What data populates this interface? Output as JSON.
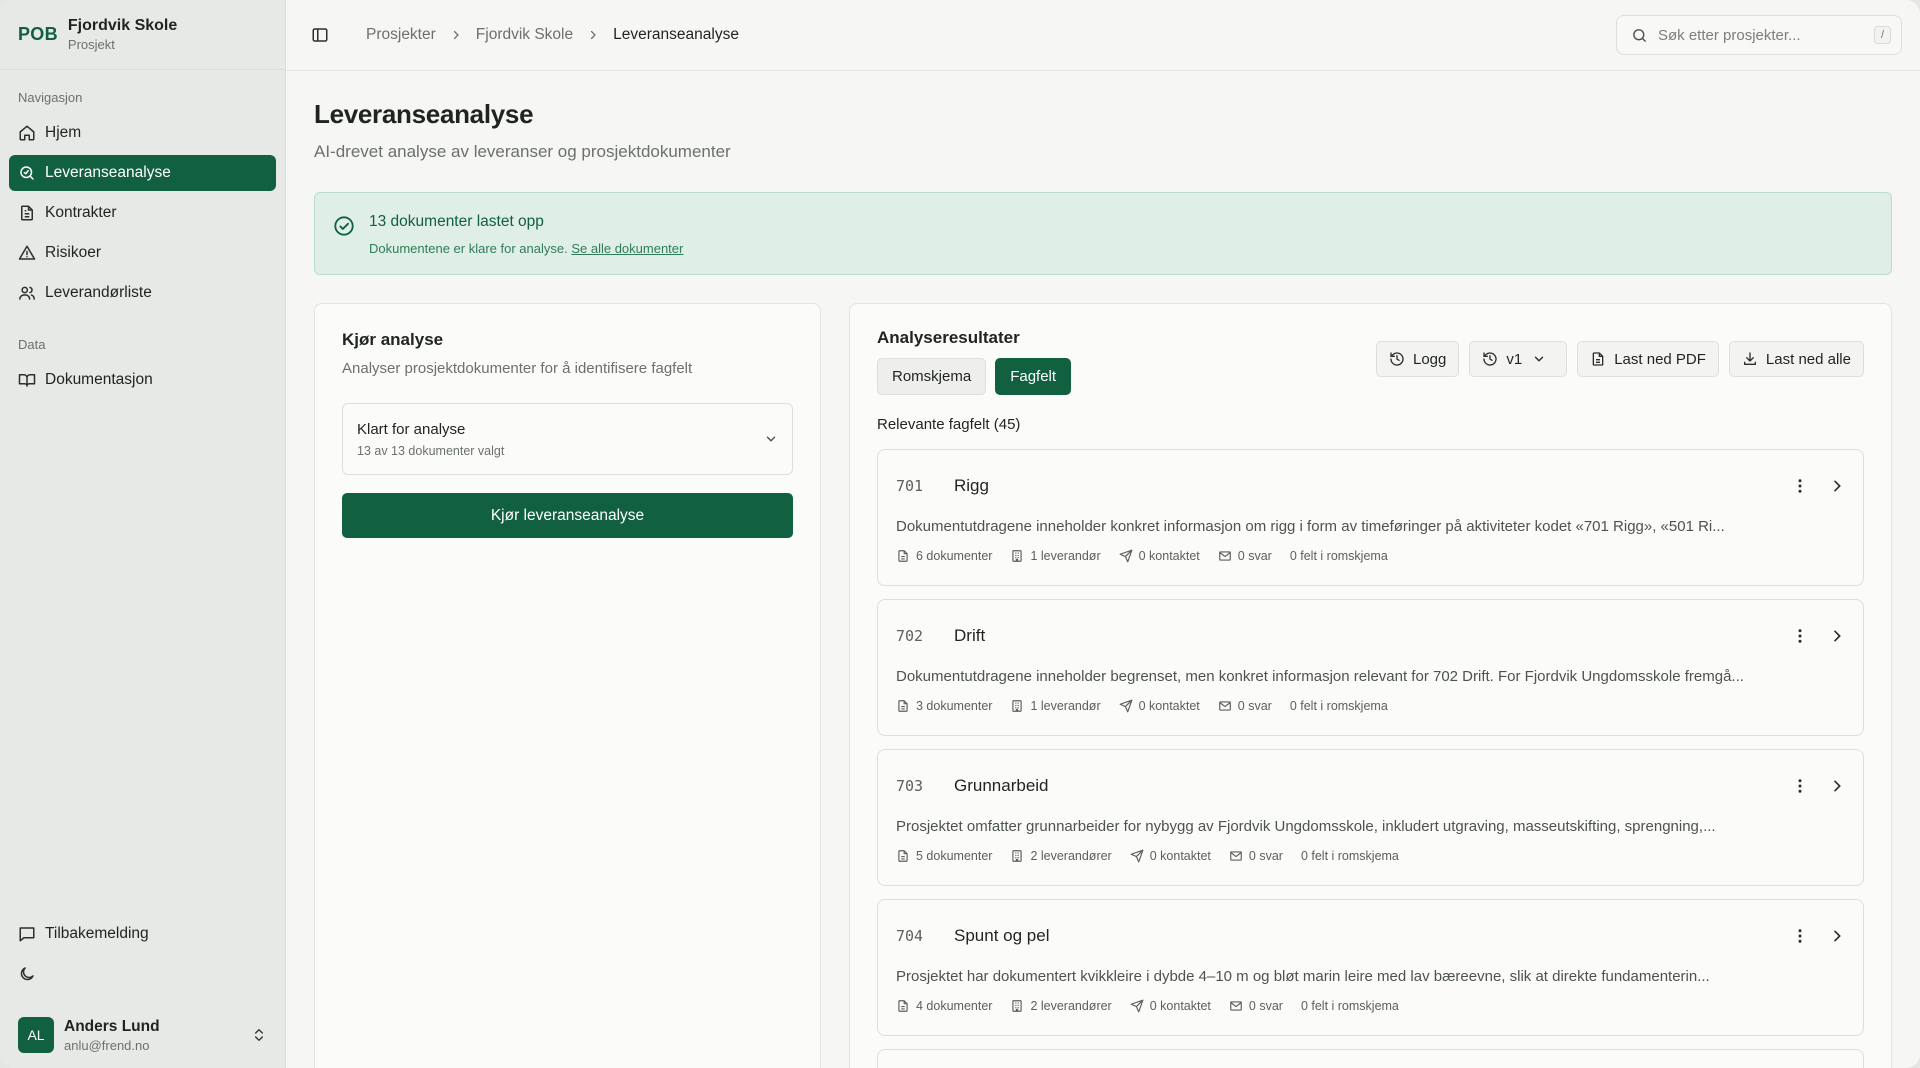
{
  "brand": {
    "logo": "POB",
    "title": "Fjordvik Skole",
    "subtitle": "Prosjekt"
  },
  "sidebar": {
    "nav_label": "Navigasjon",
    "items": [
      {
        "label": "Hjem",
        "icon": "home-icon"
      },
      {
        "label": "Leveranseanalyse",
        "icon": "search-analysis-icon",
        "active": true
      },
      {
        "label": "Kontrakter",
        "icon": "document-icon"
      },
      {
        "label": "Risikoer",
        "icon": "warning-icon"
      },
      {
        "label": "Leverandørliste",
        "icon": "users-icon"
      }
    ],
    "data_label": "Data",
    "data_items": [
      {
        "label": "Dokumentasjon",
        "icon": "book-icon"
      }
    ],
    "feedback_label": "Tilbakemelding",
    "user": {
      "initials": "AL",
      "name": "Anders Lund",
      "email": "anlu@frend.no"
    }
  },
  "breadcrumbs": [
    "Prosjekter",
    "Fjordvik Skole",
    "Leveranseanalyse"
  ],
  "search": {
    "placeholder": "Søk etter prosjekter...",
    "shortcut": "/"
  },
  "page": {
    "title": "Leveranseanalyse",
    "subtitle": "AI-drevet analyse av leveranser og prosjektdokumenter"
  },
  "banner": {
    "title": "13 dokumenter lastet opp",
    "text": "Dokumentene er klare for analyse.",
    "link": "Se alle dokumenter"
  },
  "run_card": {
    "title": "Kjør analyse",
    "subtitle": "Analyser prosjektdokumenter for å identifisere fagfelt",
    "select_label": "Klart for analyse",
    "select_sub": "13 av 13 dokumenter valgt",
    "button": "Kjør leveranseanalyse"
  },
  "results": {
    "title": "Analyseresultater",
    "tabs": [
      "Romskjema",
      "Fagfelt"
    ],
    "active_tab": "Fagfelt",
    "actions": {
      "log": "Logg",
      "version": "v1",
      "pdf": "Last ned PDF",
      "all": "Last ned alle"
    },
    "section_label": "Relevante fagfelt (45)",
    "items": [
      {
        "code": "701",
        "name": "Rigg",
        "desc": "Dokumentutdragene inneholder konkret informasjon om rigg i form av timeføringer på aktiviteter kodet «701 Rigg», «501 Ri...",
        "docs": "6 dokumenter",
        "suppliers": "1 leverandør",
        "contacted": "0 kontaktet",
        "answers": "0 svar",
        "fields": "0 felt i romskjema"
      },
      {
        "code": "702",
        "name": "Drift",
        "desc": "Dokumentutdragene inneholder begrenset, men konkret informasjon relevant for 702 Drift. For Fjordvik Ungdomsskole fremgå...",
        "docs": "3 dokumenter",
        "suppliers": "1 leverandør",
        "contacted": "0 kontaktet",
        "answers": "0 svar",
        "fields": "0 felt i romskjema"
      },
      {
        "code": "703",
        "name": "Grunnarbeid",
        "desc": "Prosjektet omfatter grunnarbeider for nybygg av Fjordvik Ungdomsskole, inkludert utgraving, masseutskifting, sprengning,...",
        "docs": "5 dokumenter",
        "suppliers": "2 leverandører",
        "contacted": "0 kontaktet",
        "answers": "0 svar",
        "fields": "0 felt i romskjema"
      },
      {
        "code": "704",
        "name": "Spunt og pel",
        "desc": "Prosjektet har dokumentert kvikkleire i dybde 4–10 m og bløt marin leire med lav bæreevne, slik at direkte fundamenterin...",
        "docs": "4 dokumenter",
        "suppliers": "2 leverandører",
        "contacted": "0 kontaktet",
        "answers": "0 svar",
        "fields": "0 felt i romskjema"
      }
    ]
  },
  "colors": {
    "accent": "#11603f",
    "banner_bg": "#dfeee6",
    "sidebar_bg": "#e6e9e5"
  }
}
